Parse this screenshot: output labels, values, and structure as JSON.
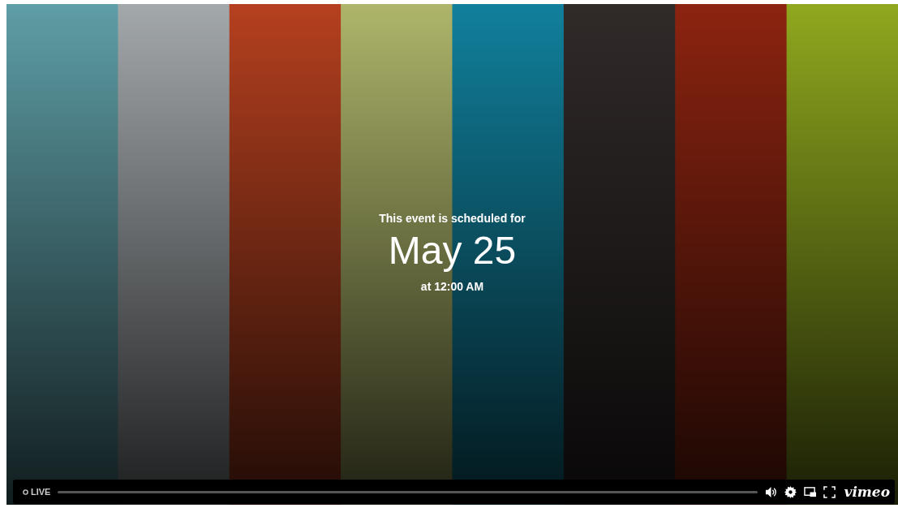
{
  "event": {
    "heading": "This event is scheduled for",
    "date": "May 25",
    "time": "at 12:00 AM"
  },
  "controls": {
    "live_label": "LIVE",
    "logo": "vimeo"
  }
}
